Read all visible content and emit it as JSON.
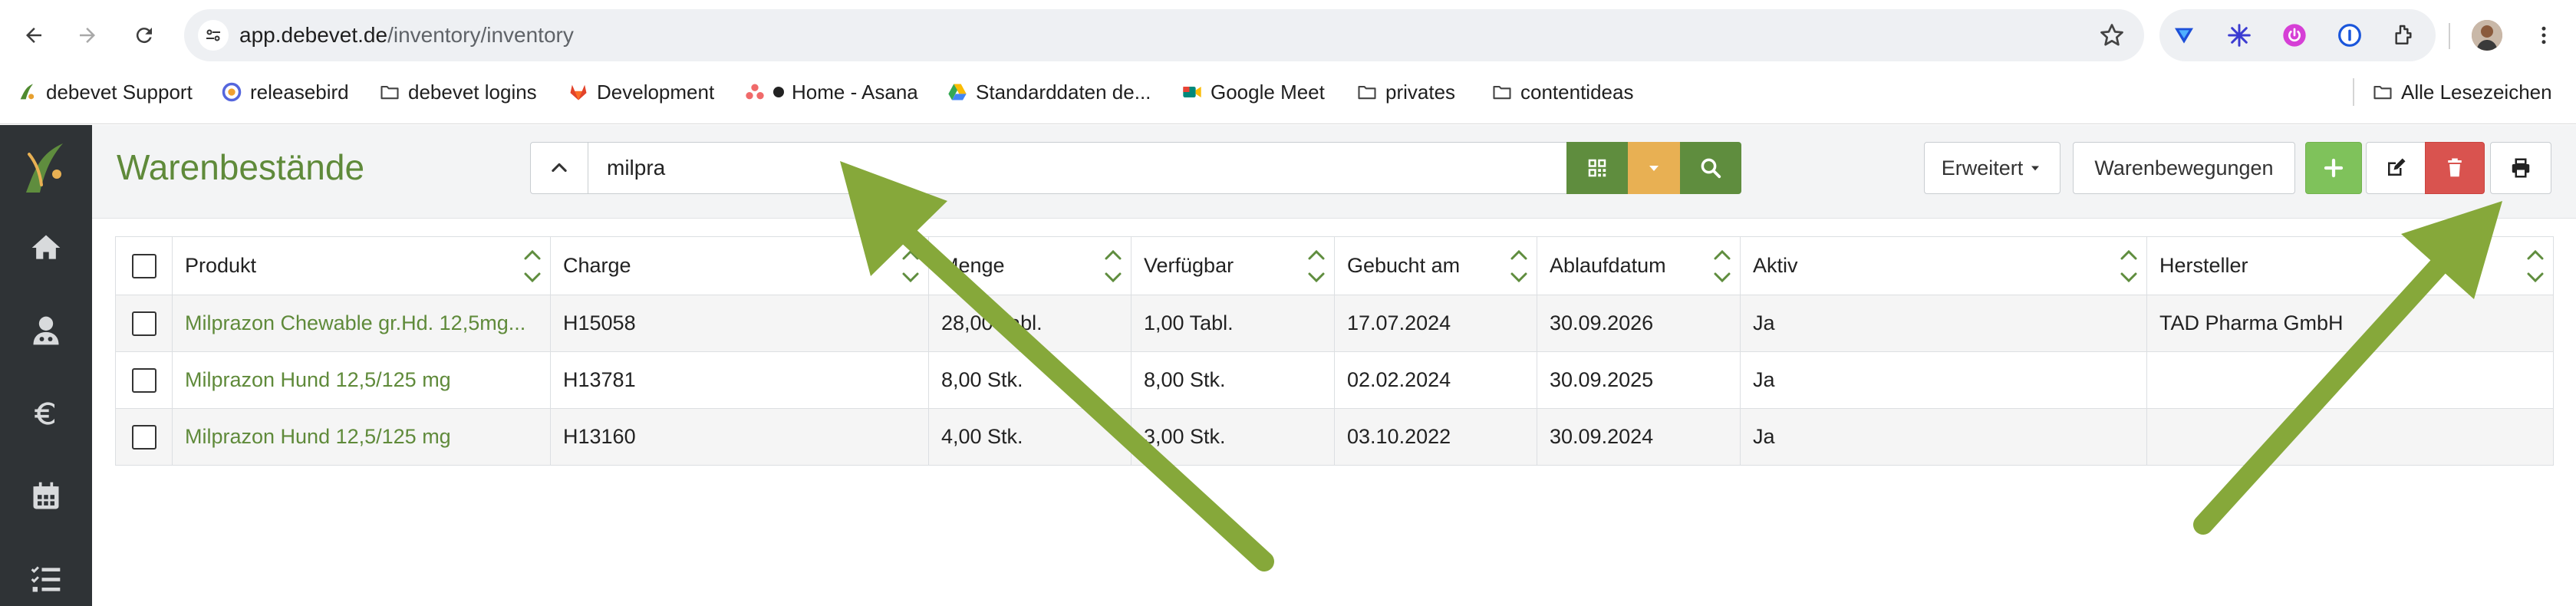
{
  "browser": {
    "url_host": "app.debevet.de",
    "url_path": "/inventory/inventory",
    "bookmarks": [
      {
        "label": "debevet Support",
        "icon": "debevet-icon"
      },
      {
        "label": "releasebird",
        "icon": "releasebird-icon"
      },
      {
        "label": "debevet logins",
        "icon": "folder-icon"
      },
      {
        "label": "Development",
        "icon": "gitlab-icon"
      },
      {
        "label": "Home - Asana",
        "icon": "asana-icon"
      },
      {
        "label": "Standarddaten de...",
        "icon": "google-drive-icon"
      },
      {
        "label": "Google Meet",
        "icon": "google-meet-icon"
      },
      {
        "label": "privates",
        "icon": "folder-icon"
      },
      {
        "label": "contentideas",
        "icon": "folder-icon"
      }
    ],
    "all_bookmarks_label": "Alle Lesezeichen"
  },
  "page": {
    "title": "Warenbestände",
    "search_value": "milpra"
  },
  "toolbar": {
    "erweitert_label": "Erweitert",
    "warenbewegungen_label": "Warenbewegungen"
  },
  "colors": {
    "brand_green": "#5f8d3e",
    "title_green": "#5f8a3a",
    "add_green": "#7fc25b",
    "dropdown_orange": "#e8b053",
    "delete_red": "#d9534f",
    "sidebar_dark": "#2f3336",
    "arrow_green": "#86a83a"
  },
  "table": {
    "columns": [
      "Produkt",
      "Charge",
      "Menge",
      "Verfügbar",
      "Gebucht am",
      "Ablaufdatum",
      "Aktiv",
      "Hersteller"
    ],
    "rows": [
      {
        "produkt": "Milprazon Chewable gr.Hd. 12,5mg...",
        "charge": "H15058",
        "menge": "28,00 Tabl.",
        "verfuegbar": "1,00 Tabl.",
        "gebucht": "17.07.2024",
        "ablauf": "30.09.2026",
        "aktiv": "Ja",
        "hersteller": "TAD Pharma GmbH"
      },
      {
        "produkt": "Milprazon Hund 12,5/125 mg",
        "charge": "H13781",
        "menge": "8,00 Stk.",
        "verfuegbar": "8,00 Stk.",
        "gebucht": "02.02.2024",
        "ablauf": "30.09.2025",
        "aktiv": "Ja",
        "hersteller": ""
      },
      {
        "produkt": "Milprazon Hund 12,5/125 mg",
        "charge": "H13160",
        "menge": "4,00 Stk.",
        "verfuegbar": "3,00 Stk.",
        "gebucht": "03.10.2022",
        "ablauf": "30.09.2024",
        "aktiv": "Ja",
        "hersteller": ""
      }
    ]
  }
}
